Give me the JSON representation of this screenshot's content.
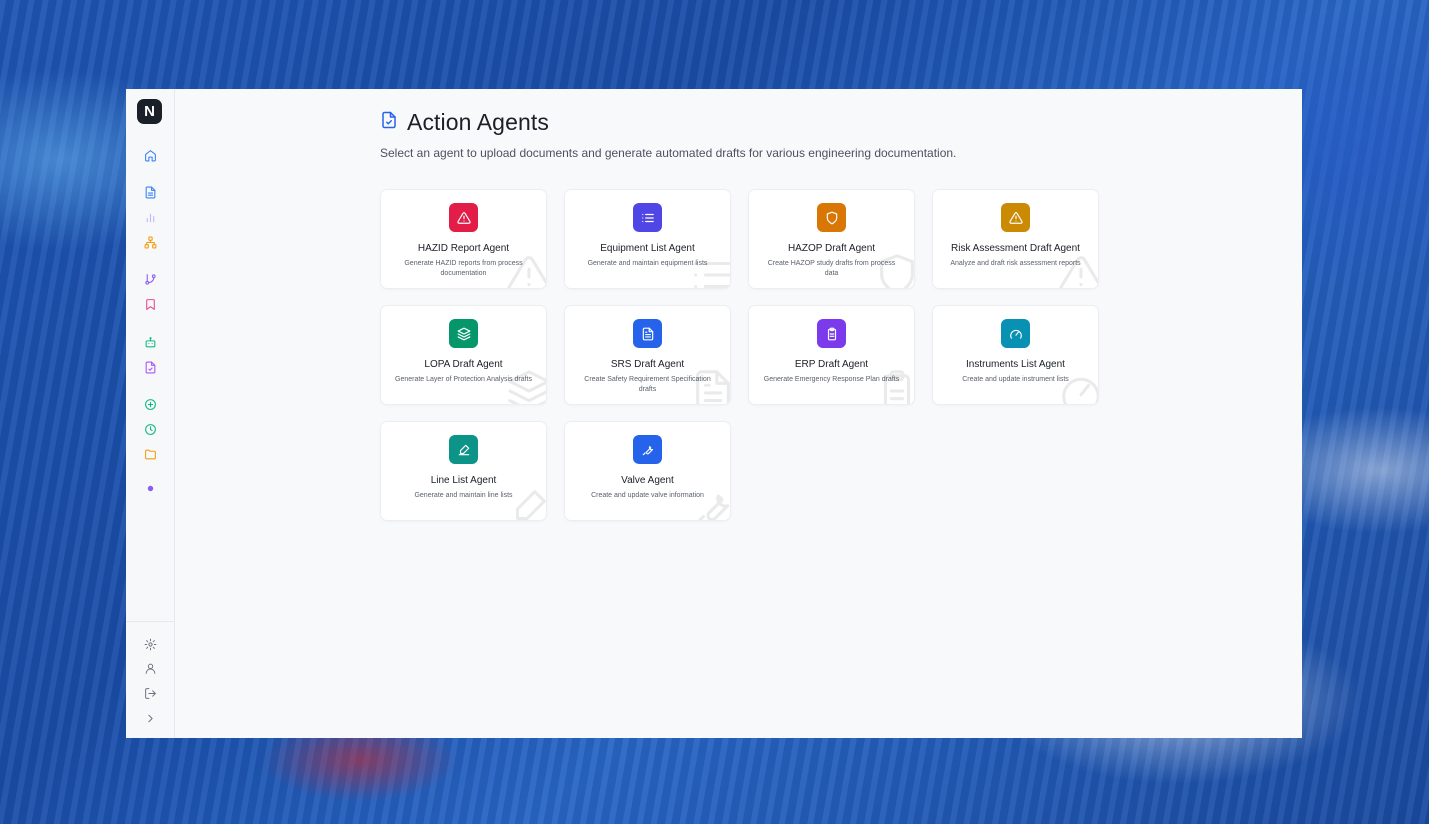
{
  "page": {
    "title": "Action Agents",
    "subtitle": "Select an agent to upload documents and generate automated drafts for various engineering documentation."
  },
  "brand": {
    "logo_letter": "N"
  },
  "sidebar": {
    "items": [
      {
        "name": "home-icon",
        "icon": "home",
        "color": "#3b82f6"
      },
      {
        "name": "document-icon",
        "icon": "document",
        "color": "#3b82f6"
      },
      {
        "name": "bar-chart-icon",
        "icon": "bars",
        "color": "#c4b5fd"
      },
      {
        "name": "network-icon",
        "icon": "network",
        "color": "#f59e0b"
      },
      {
        "name": "git-branch-icon",
        "icon": "branch",
        "color": "#8b5cf6"
      },
      {
        "name": "bookmark-icon",
        "icon": "bookmark",
        "color": "#ec4899"
      },
      {
        "name": "bot-icon",
        "icon": "bot",
        "color": "#10b981"
      },
      {
        "name": "file-check-icon",
        "icon": "filecheck",
        "color": "#a855f7"
      },
      {
        "name": "plus-circle-icon",
        "icon": "pluscircle",
        "color": "#10b981"
      },
      {
        "name": "clock-icon",
        "icon": "clock",
        "color": "#10b981"
      },
      {
        "name": "folder-icon",
        "icon": "folder",
        "color": "#f59e0b"
      },
      {
        "name": "dot-icon",
        "icon": "dot",
        "color": "#8b5cf6"
      }
    ],
    "bottom": [
      {
        "name": "settings-icon",
        "icon": "gear",
        "color": "#6b7280"
      },
      {
        "name": "user-icon",
        "icon": "user",
        "color": "#6b7280"
      },
      {
        "name": "logout-icon",
        "icon": "logout",
        "color": "#6b7280"
      },
      {
        "name": "expand-chevron-icon",
        "icon": "chevron",
        "color": "#6b7280"
      }
    ]
  },
  "agents": [
    {
      "name": "HAZID Report Agent",
      "description": "Generate HAZID reports from process documentation",
      "icon": "warning",
      "color": "#e11d48"
    },
    {
      "name": "Equipment List Agent",
      "description": "Generate and maintain equipment lists",
      "icon": "list",
      "color": "#4f46e5"
    },
    {
      "name": "HAZOP Draft Agent",
      "description": "Create HAZOP study drafts from process data",
      "icon": "shield",
      "color": "#d97706"
    },
    {
      "name": "Risk Assessment Draft Agent",
      "description": "Analyze and draft risk assessment reports",
      "icon": "warning",
      "color": "#ca8a04"
    },
    {
      "name": "LOPA Draft Agent",
      "description": "Generate Layer of Protection Analysis drafts",
      "icon": "layers",
      "color": "#059669"
    },
    {
      "name": "SRS Draft Agent",
      "description": "Create Safety Requirement Specification drafts",
      "icon": "doc",
      "color": "#2563eb"
    },
    {
      "name": "ERP Draft Agent",
      "description": "Generate Emergency Response Plan drafts",
      "icon": "clipboard",
      "color": "#7c3aed"
    },
    {
      "name": "Instruments List Agent",
      "description": "Create and update instrument lists",
      "icon": "gauge",
      "color": "#0891b2"
    },
    {
      "name": "Line List Agent",
      "description": "Generate and maintain line lists",
      "icon": "pen",
      "color": "#0d9488"
    },
    {
      "name": "Valve Agent",
      "description": "Create and update valve information",
      "icon": "wrench",
      "color": "#2563eb"
    }
  ]
}
